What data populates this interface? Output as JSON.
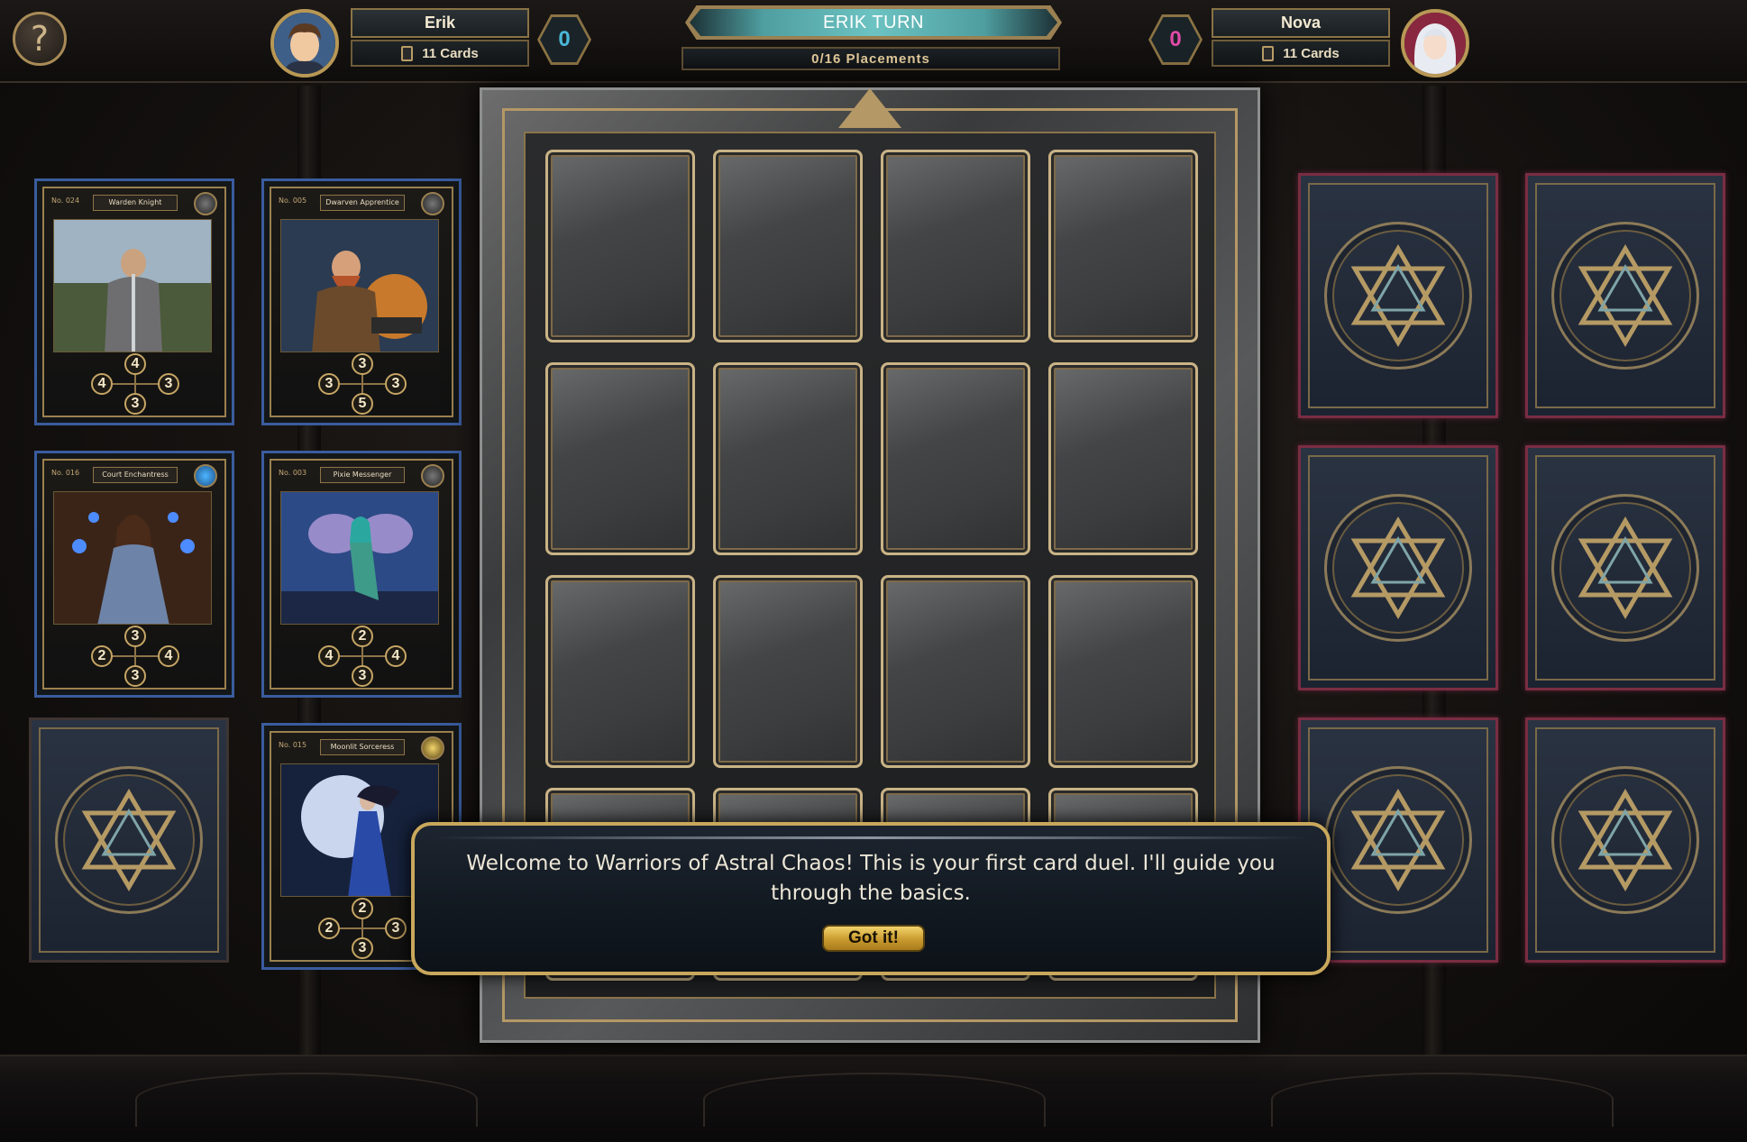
{
  "player": {
    "name": "Erik",
    "cards_label": "11 Cards",
    "score": "0",
    "score_color": "#4ab7d8"
  },
  "opponent": {
    "name": "Nova",
    "cards_label": "11 Cards",
    "score": "0",
    "score_color": "#e04aa8"
  },
  "turn_banner": "ERIK TURN",
  "placements": "0/16 Placements",
  "help_icon": "question-mark-icon",
  "hand": [
    {
      "no": "No. 024",
      "title": "Warden Knight",
      "element": "moon-icon",
      "up": "4",
      "left": "4",
      "right": "3",
      "down": "3",
      "art": "knight"
    },
    {
      "no": "No. 005",
      "title": "Dwarven Apprentice",
      "element": "rune-icon",
      "up": "3",
      "left": "3",
      "right": "3",
      "down": "5",
      "art": "dwarf"
    },
    {
      "no": "No. 016",
      "title": "Court Enchantress",
      "element": "water-icon",
      "up": "3",
      "left": "2",
      "right": "4",
      "down": "3",
      "art": "enchantress"
    },
    {
      "no": "No. 003",
      "title": "Pixie Messenger",
      "element": "wind-icon",
      "up": "2",
      "left": "4",
      "right": "4",
      "down": "3",
      "art": "pixie"
    },
    {
      "no": "No. 015",
      "title": "Moonlit Sorceress",
      "element": "light-icon",
      "up": "2",
      "left": "2",
      "right": "3",
      "down": "3",
      "art": "sorceress"
    }
  ],
  "opponent_hand_count": 6,
  "dialog": {
    "message": "Welcome to Warriors of Astral Chaos! This is your first card duel. I'll guide you through the basics.",
    "button": "Got it!"
  }
}
